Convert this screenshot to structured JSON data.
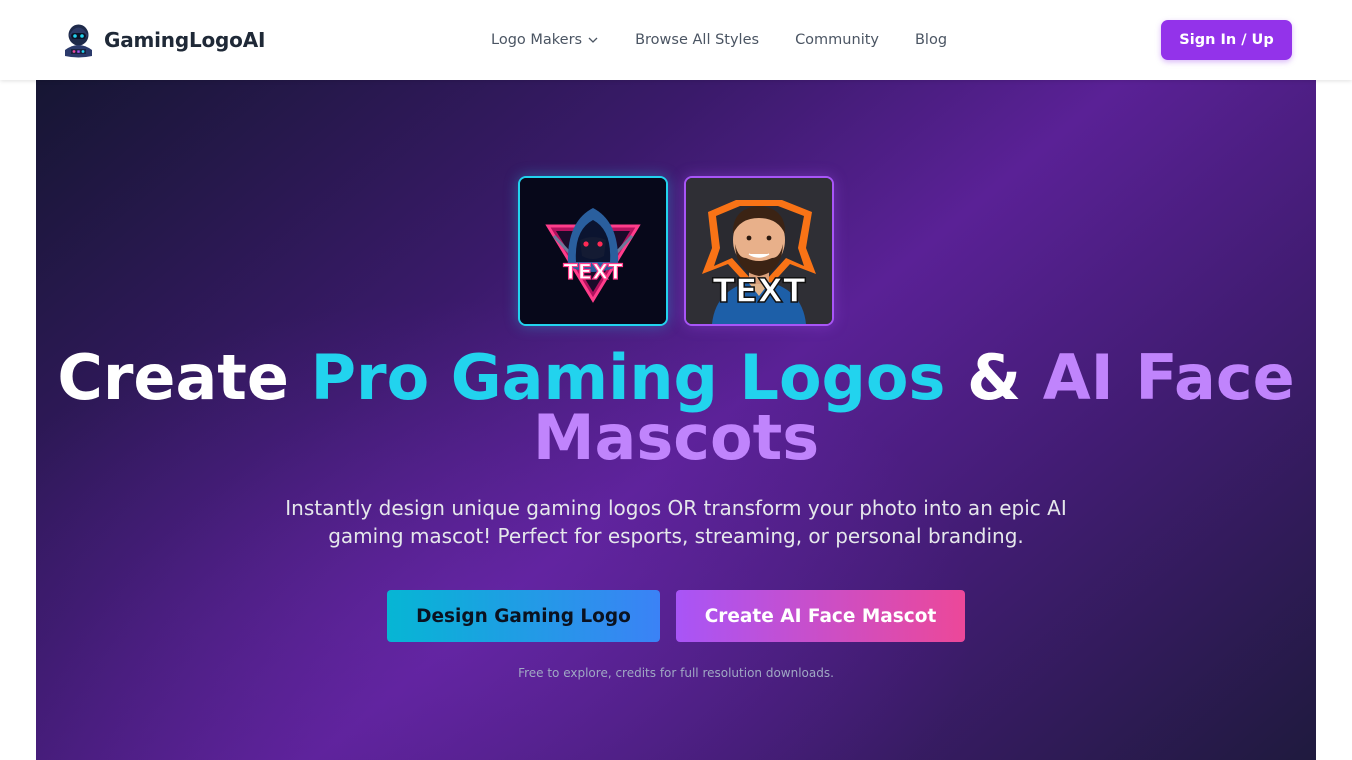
{
  "navbar": {
    "brand_name": "GamingLogoAI",
    "brand_icon": "robot-gamer-icon",
    "links": [
      {
        "label": "Logo Makers",
        "has_dropdown": true
      },
      {
        "label": "Browse All Styles"
      },
      {
        "label": "Community"
      },
      {
        "label": "Blog"
      }
    ],
    "signin_label": "Sign In / Up"
  },
  "hero": {
    "thumbnails": [
      {
        "name": "hooded-assassin-logo",
        "text": "TEXT",
        "border_color": "#22d3ee"
      },
      {
        "name": "bearded-man-mascot",
        "text": "TEXT",
        "border_color": "#a855f7"
      }
    ],
    "headline": {
      "part1": "Create ",
      "part2": "Pro Gaming Logos",
      "part3": " & ",
      "part4": "AI Face Mascots"
    },
    "subtitle": "Instantly design unique gaming logos OR transform your photo into an epic AI gaming mascot! Perfect for esports, streaming, or personal branding.",
    "primary_cta": "Design Gaming Logo",
    "secondary_cta": "Create AI Face Mascot",
    "fineprint": "Free to explore, credits for full resolution downloads."
  },
  "colors": {
    "accent_purple": "#9333ea",
    "headline_cyan": "#22d3ee",
    "headline_purple": "#c084fc"
  }
}
